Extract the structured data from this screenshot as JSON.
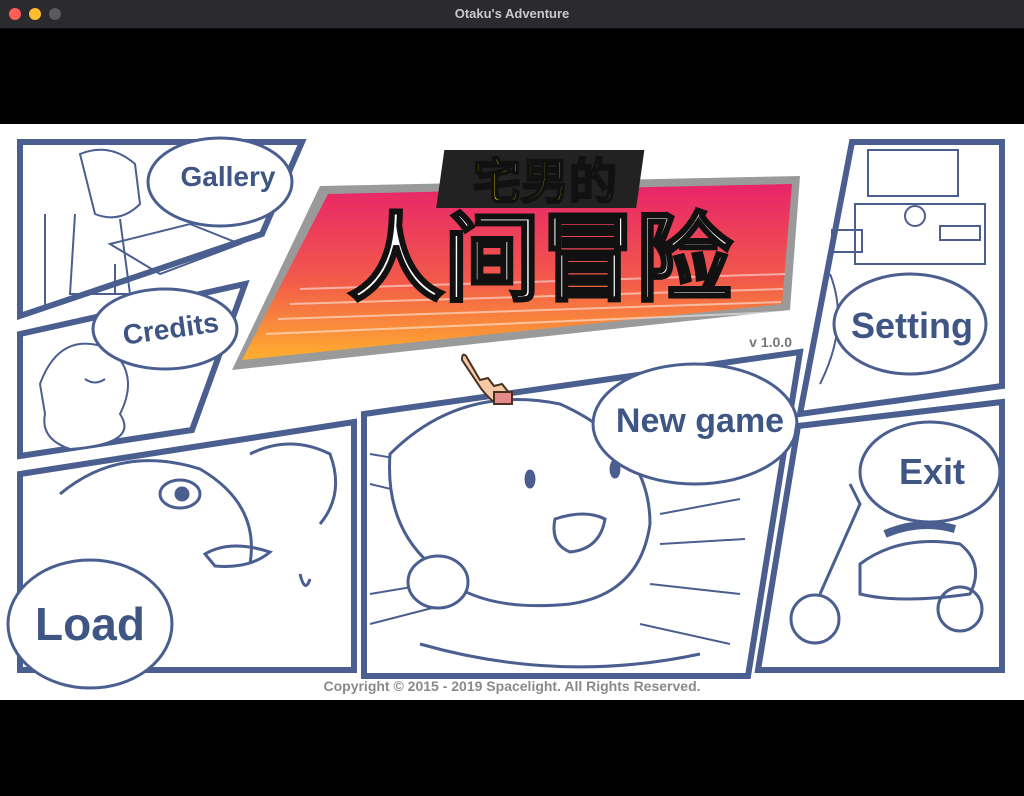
{
  "window": {
    "title": "Otaku's Adventure"
  },
  "game": {
    "title_line1": "宅男的",
    "title_line2": "人间冒险",
    "version": "v 1.0.0",
    "copyright": "Copyright © 2015 - 2019 Spacelight. All Rights Reserved."
  },
  "menu": {
    "gallery": "Gallery",
    "credits": "Credits",
    "load": "Load",
    "new_game": "New game",
    "setting": "Setting",
    "exit": "Exit"
  },
  "colors": {
    "panel_border": "#4a5f8f",
    "label_text": "#3f5685",
    "title_yellow": "#ffe40a",
    "title_pink": "#e8246a",
    "title_orange": "#ffb030"
  }
}
